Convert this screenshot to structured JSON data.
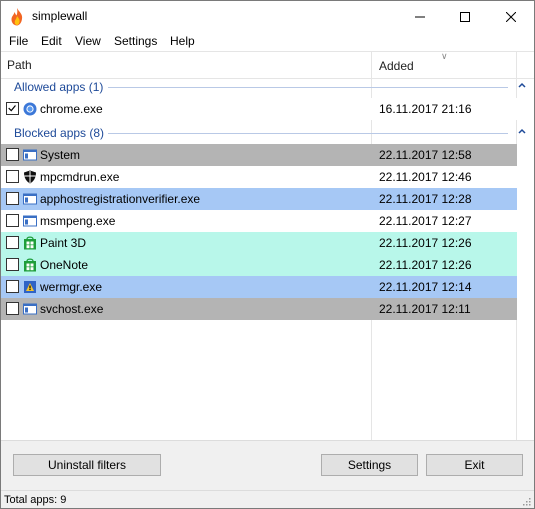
{
  "window": {
    "title": "simplewall"
  },
  "menu": [
    "File",
    "Edit",
    "View",
    "Settings",
    "Help"
  ],
  "columns": {
    "path": "Path",
    "added": "Added"
  },
  "groups": {
    "allowed": "Allowed apps (1)",
    "blocked": "Blocked apps (8)"
  },
  "allowed_rows": [
    {
      "name": "chrome.exe",
      "date": "16.11.2017 21:16",
      "checked": true,
      "icon": "chrome-icon",
      "bg": "#ffffff"
    }
  ],
  "blocked_rows": [
    {
      "name": "System",
      "date": "22.11.2017 12:58",
      "checked": false,
      "icon": "system-window-icon",
      "bg": "#b4b4b4"
    },
    {
      "name": "mpcmdrun.exe",
      "date": "22.11.2017 12:46",
      "checked": false,
      "icon": "defender-shield-icon",
      "bg": "#ffffff"
    },
    {
      "name": "apphostregistrationverifier.exe",
      "date": "22.11.2017 12:28",
      "checked": false,
      "icon": "system-window-icon",
      "bg": "#a6c8f5"
    },
    {
      "name": "msmpeng.exe",
      "date": "22.11.2017 12:27",
      "checked": false,
      "icon": "system-window-icon",
      "bg": "#ffffff"
    },
    {
      "name": "Paint 3D",
      "date": "22.11.2017 12:26",
      "checked": false,
      "icon": "store-app-icon",
      "bg": "#b8f7ea"
    },
    {
      "name": "OneNote",
      "date": "22.11.2017 12:26",
      "checked": false,
      "icon": "store-app-icon",
      "bg": "#b8f7ea"
    },
    {
      "name": "wermgr.exe",
      "date": "22.11.2017 12:14",
      "checked": false,
      "icon": "error-reporting-icon",
      "bg": "#a6c8f5"
    },
    {
      "name": "svchost.exe",
      "date": "22.11.2017 12:11",
      "checked": false,
      "icon": "system-window-icon",
      "bg": "#b4b4b4"
    }
  ],
  "buttons": {
    "uninstall": "Uninstall filters",
    "settings": "Settings",
    "exit": "Exit"
  },
  "status": "Total apps: 9"
}
